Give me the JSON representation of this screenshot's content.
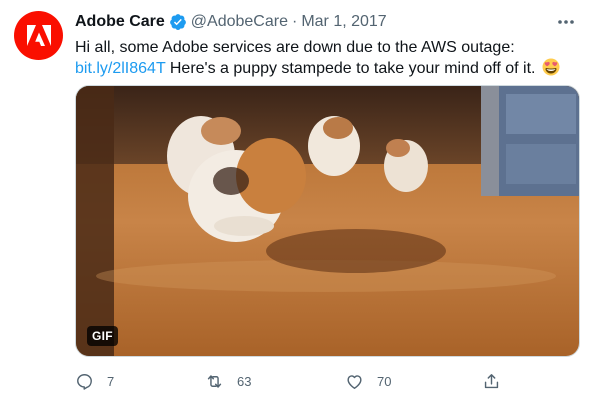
{
  "author": {
    "name": "Adobe Care",
    "handle": "@AdobeCare",
    "separator": "·",
    "date": "Mar 1, 2017",
    "avatar_color": "#fa0f00",
    "avatar_icon": "adobe-logo-icon",
    "verified_icon": "verified-badge-icon"
  },
  "tweet": {
    "text_line1": "Hi all, some Adobe services are down due to the AWS outage:",
    "link": "bit.ly/2lI864T",
    "text_line2": " Here's a puppy stampede to take your mind off of it.",
    "emoji_icon": "heart-eyes-emoji-icon"
  },
  "media": {
    "type_badge": "GIF"
  },
  "actions": {
    "reply_count": "7",
    "retweet_count": "63",
    "like_count": "70",
    "reply_icon": "reply-icon",
    "retweet_icon": "retweet-icon",
    "like_icon": "heart-icon",
    "share_icon": "share-icon",
    "more_icon": "more-icon"
  },
  "colors": {
    "link": "#1d9bf0",
    "secondary_text": "#536471",
    "primary_text": "#0f1419"
  }
}
